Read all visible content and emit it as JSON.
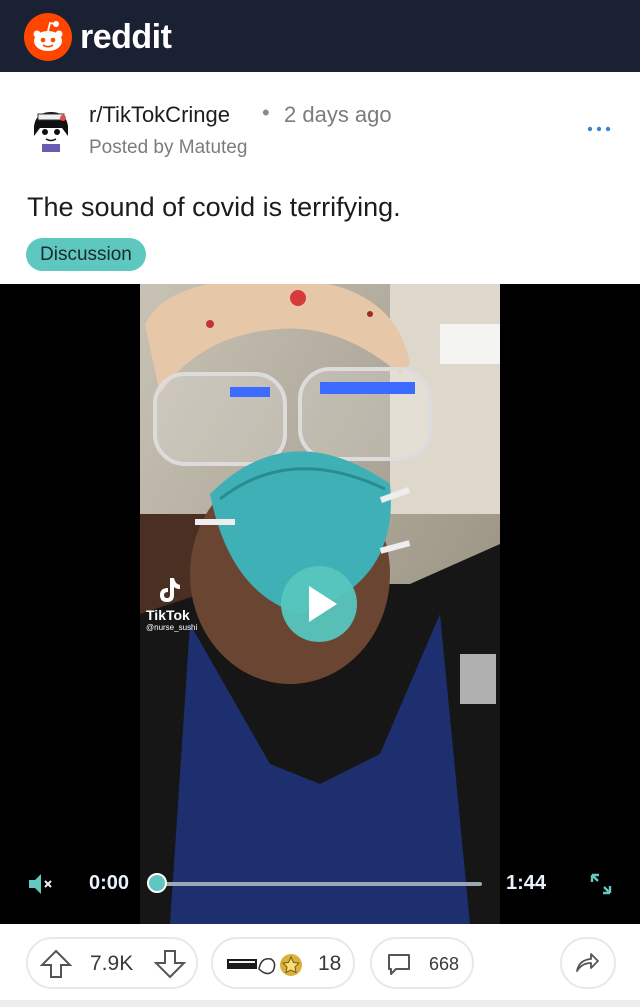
{
  "app": {
    "name": "reddit"
  },
  "post": {
    "subreddit": "r/TikTokCringe",
    "separator": "•",
    "age": "2 days ago",
    "posted_by": "Posted by Matuteg",
    "title": "The sound of covid is terrifying.",
    "flair": "Discussion"
  },
  "video": {
    "watermark_name": "TikTok",
    "watermark_handle": "@nurse_sushi",
    "current_time": "0:00",
    "duration": "1:44",
    "progress": 0.0
  },
  "actions": {
    "upvotes": "7.9K",
    "awards": "18",
    "comments": "668"
  },
  "colors": {
    "topbar": "#1a2133",
    "accent": "#5ec8c0",
    "reddit_orange": "#ff4500"
  },
  "icons": [
    "reddit-logo-icon",
    "more-options-icon",
    "mute-icon",
    "play-icon",
    "expand-icon",
    "upvote-icon",
    "downvote-icon",
    "award-icon",
    "comment-icon",
    "share-icon"
  ]
}
